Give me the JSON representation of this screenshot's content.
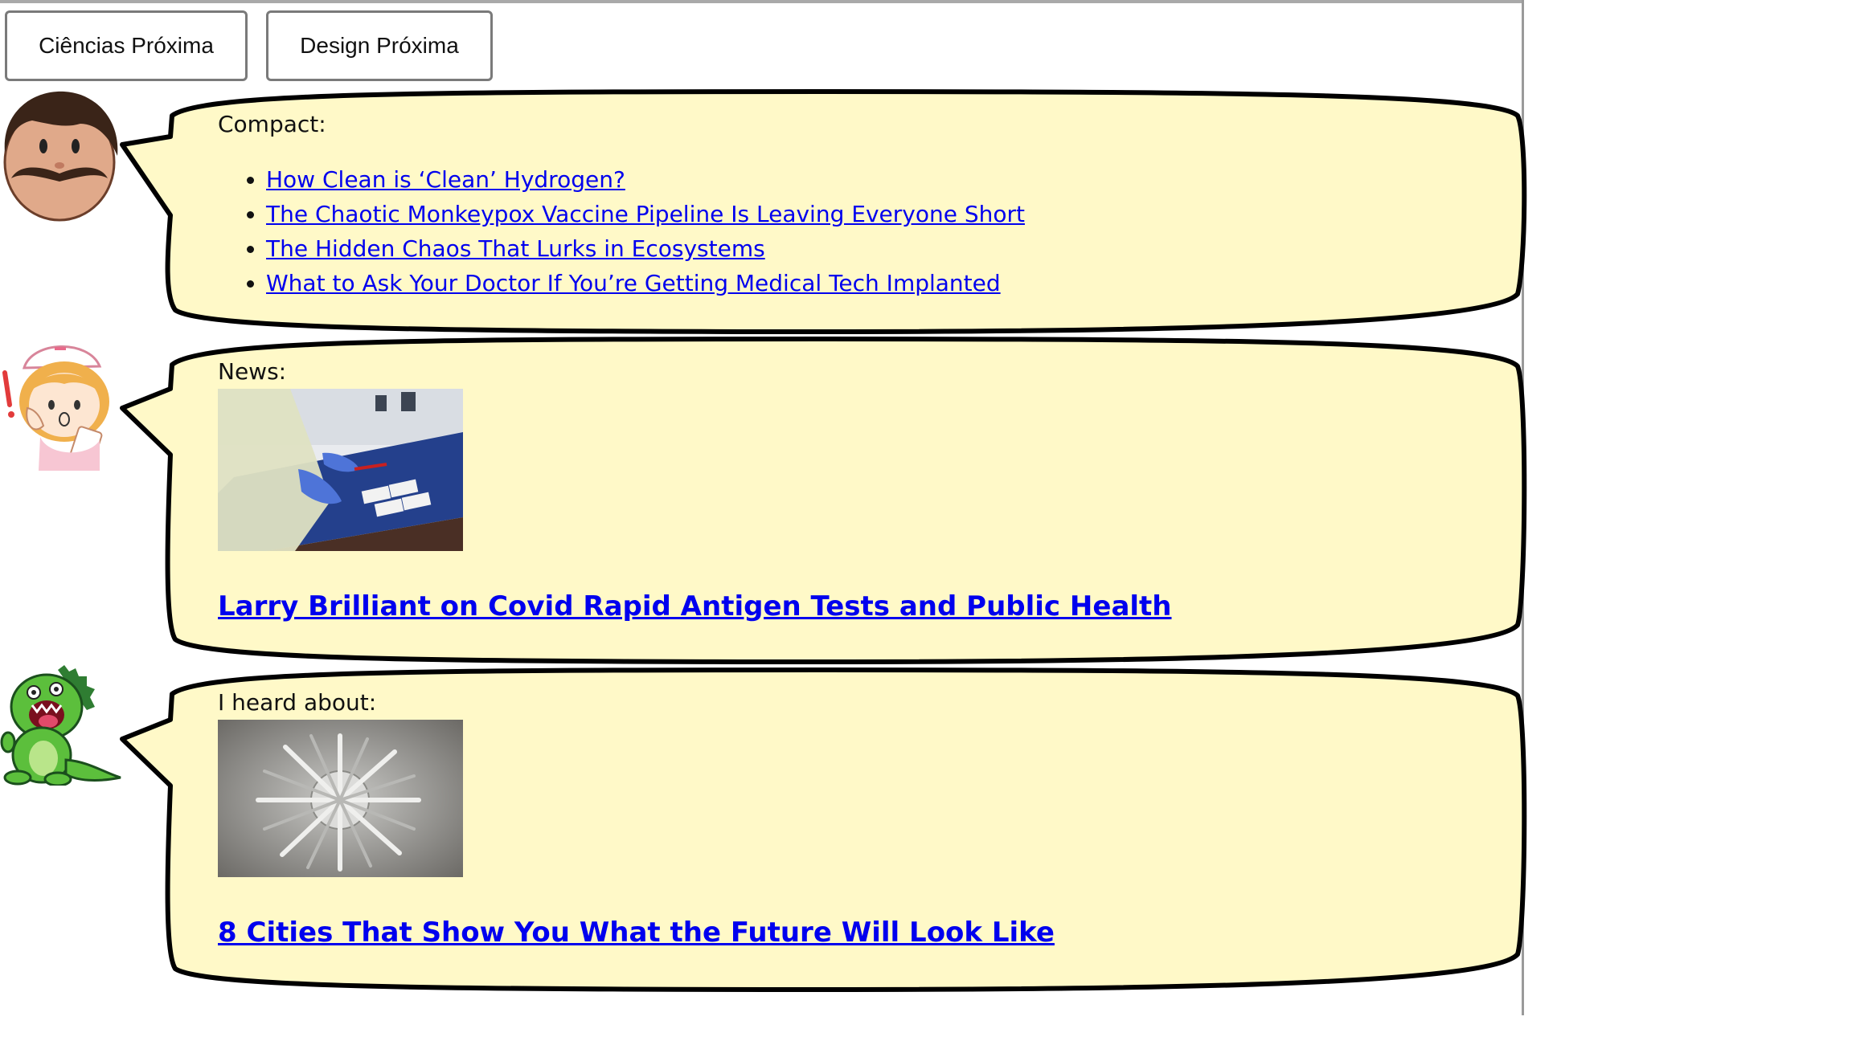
{
  "nav": {
    "buttons": [
      {
        "label": "Ciências Próxima"
      },
      {
        "label": "Design Próxima"
      }
    ]
  },
  "bubbles": [
    {
      "avatar": "mustache-man-icon",
      "label": "Compact:",
      "links": [
        {
          "text": "How Clean is ‘Clean’ Hydrogen?"
        },
        {
          "text": "The Chaotic Monkeypox Vaccine Pipeline Is Leaving Everyone Short"
        },
        {
          "text": "The Hidden Chaos That Lurks in Ecosystems"
        },
        {
          "text": "What to Ask Your Doctor If You’re Getting Medical Tech Implanted"
        }
      ]
    },
    {
      "avatar": "nurse-icon",
      "label": "News:",
      "image": "lab-testing-photo",
      "headline": "Larry Brilliant on Covid Rapid Antigen Tests and Public Health"
    },
    {
      "avatar": "green-dinosaur-icon",
      "label": "I heard about:",
      "image": "spiky-city-sculpture-photo",
      "headline": "8 Cities That Show You What the Future Will Look Like"
    }
  ],
  "colors": {
    "bubble_fill": "#fff9c8",
    "bubble_stroke": "#000000",
    "link": "#0000ee"
  }
}
